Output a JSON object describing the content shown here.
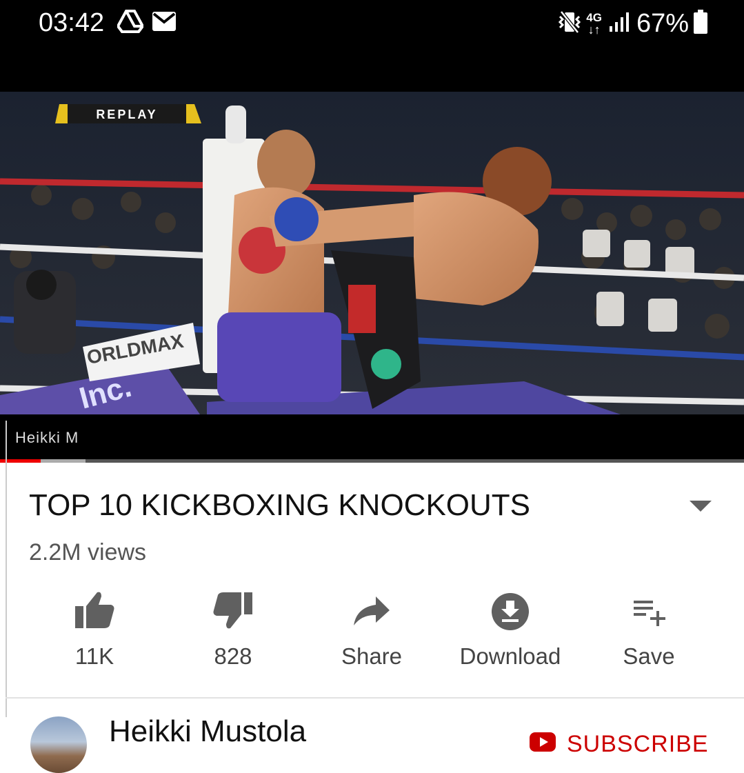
{
  "status_bar": {
    "time": "03:42",
    "icons": [
      "google-drive-icon",
      "gmail-icon",
      "vibrate-icon",
      "4g-icon",
      "signal-icon",
      "battery-icon"
    ],
    "network": "4G",
    "battery": "67%"
  },
  "video": {
    "overlay_replay": "REPLAY",
    "ad_text_left": "ORLDMAX",
    "ad_text_bottom": "Inc.",
    "watermark": "Heikki M",
    "progress_played_fraction": 0.055,
    "progress_buffered_fraction": 0.115
  },
  "video_info": {
    "title": "TOP 10 KICKBOXING KNOCKOUTS",
    "views": "2.2M views"
  },
  "actions": {
    "like_label": "11K",
    "dislike_label": "828",
    "share_label": "Share",
    "download_label": "Download",
    "save_label": "Save"
  },
  "channel": {
    "name": "Heikki Mustola",
    "subscribe_label": "SUBSCRIBE"
  },
  "colors": {
    "accent_red": "#cc0000",
    "status_bar": "#000000",
    "icon_gray": "#606060"
  }
}
